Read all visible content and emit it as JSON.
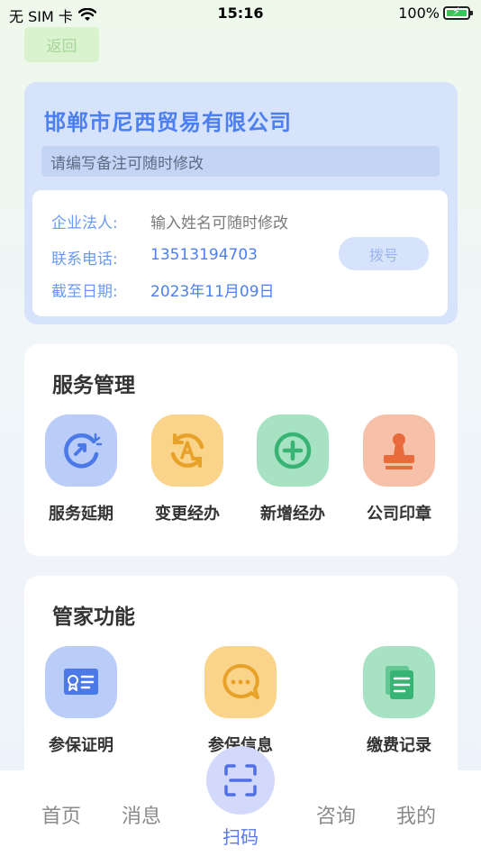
{
  "status_bar": {
    "carrier": "无 SIM 卡",
    "time": "15:16",
    "battery": "100%"
  },
  "back_label": "返回",
  "company": {
    "name": "邯郸市尼西贸易有限公司",
    "remark": "请编写备注可随时修改",
    "legal_rep_label": "企业法人:",
    "legal_rep_value": "输入姓名可随时修改",
    "phone_label": "联系电话:",
    "phone_value": "13513194703",
    "dial_label": "拨号",
    "date_label": "截至日期:",
    "date_value": "2023年11月09日"
  },
  "service": {
    "title": "服务管理",
    "items": [
      {
        "label": "服务延期",
        "icon": "service-extend-icon",
        "color": "#b9cdf8"
      },
      {
        "label": "变更经办",
        "icon": "change-handler-icon",
        "color": "#f9d48a"
      },
      {
        "label": "新增经办",
        "icon": "add-handler-icon",
        "color": "#a7e3c3"
      },
      {
        "label": "公司印章",
        "icon": "company-seal-icon",
        "color": "#f6c1a8"
      }
    ]
  },
  "steward": {
    "title": "管家功能",
    "items": [
      {
        "label": "参保证明",
        "icon": "certificate-icon",
        "color": "#b9cdf8"
      },
      {
        "label": "参保信息",
        "icon": "message-icon",
        "color": "#f9d48a"
      },
      {
        "label": "缴费记录",
        "icon": "records-icon",
        "color": "#a7e3c3"
      }
    ]
  },
  "tab_bar": {
    "home": "首页",
    "messages": "消息",
    "scan": "扫码",
    "consult": "咨询",
    "mine": "我的"
  }
}
